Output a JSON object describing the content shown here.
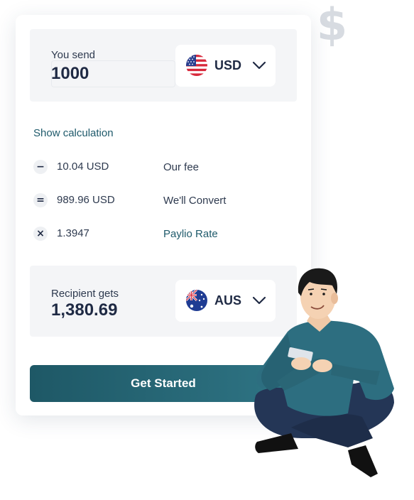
{
  "send": {
    "label": "You send",
    "amount": "1000",
    "currency": "USD",
    "flag_icon": "us-flag-icon"
  },
  "calculation": {
    "toggle_label": "Show calculation",
    "rows": [
      {
        "symbol": "−",
        "value": "10.04 USD",
        "description": "Our fee"
      },
      {
        "symbol": "=",
        "value": "989.96 USD",
        "description": "We'll Convert"
      },
      {
        "symbol": "×",
        "value": "1.3947",
        "description": "Paylio Rate"
      }
    ]
  },
  "receive": {
    "label": "Recipient gets",
    "amount": "1,380.69",
    "currency": "AUS",
    "flag_icon": "australia-flag-icon"
  },
  "cta": {
    "label": "Get Started"
  },
  "decor": {
    "symbol": "$"
  },
  "colors": {
    "accent": "#1f5a6b",
    "button_start": "#1e5866",
    "button_end": "#2f7585",
    "panel_bg": "#f4f5f7",
    "text": "#1f2a44"
  }
}
